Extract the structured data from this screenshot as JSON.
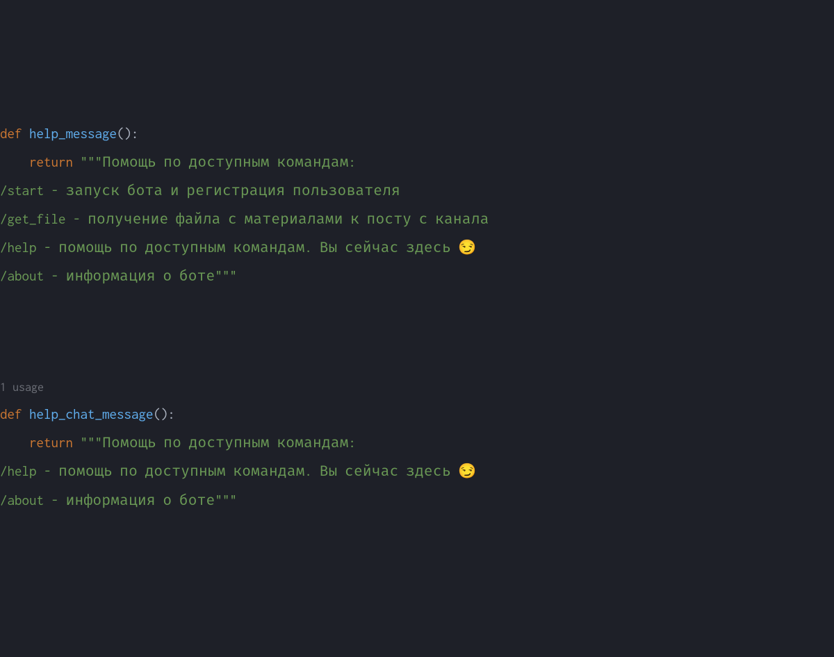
{
  "code": {
    "function1": {
      "def_keyword": "def ",
      "name": "help_message",
      "params": "():",
      "return_keyword": "    return ",
      "string_open": "\"\"\"",
      "line1": "Помощь по доступным командам:",
      "line2": "/start - запуск бота и регистрация пользователя",
      "line3": "/get_file - получение файла с материалами к посту с канала",
      "line4_a": "/help - помощь по доступным командам. Вы сейчас здесь ",
      "line4_emoji": "😏",
      "line5": "/about - информация о боте",
      "string_close": "\"\"\""
    },
    "usage_hint": "1 usage",
    "function2": {
      "def_keyword": "def ",
      "name": "help_chat_message",
      "params": "():",
      "return_keyword": "    return ",
      "string_open": "\"\"\"",
      "line1": "Помощь по доступным командам:",
      "line2_a": "/help - помощь по доступным командам. Вы сейчас здесь ",
      "line2_emoji": "😏",
      "line3": "/about - информация о боте",
      "string_close": "\"\"\""
    }
  },
  "colors": {
    "background": "#1e2028",
    "keyword": "#cd7832",
    "function_name": "#61afef",
    "default": "#abb2bf",
    "string": "#6a9955",
    "hint": "#6e7179"
  }
}
